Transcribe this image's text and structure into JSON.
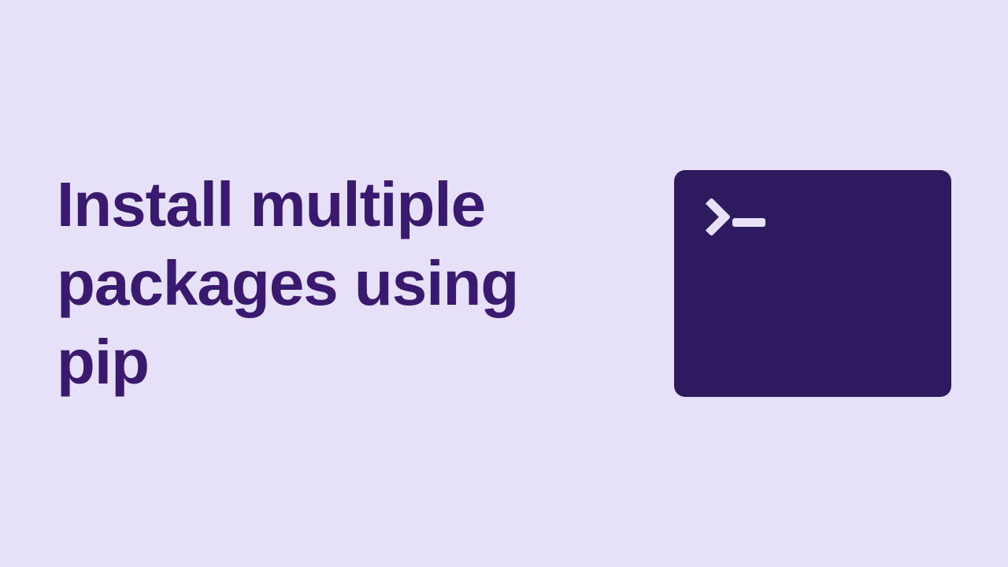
{
  "heading": "Install multiple packages using pip",
  "colors": {
    "background": "#E6E1F9",
    "text": "#3A1A6E",
    "terminal": "#2E1A5E",
    "prompt": "#E6E1F9"
  },
  "icon": {
    "name": "terminal"
  }
}
